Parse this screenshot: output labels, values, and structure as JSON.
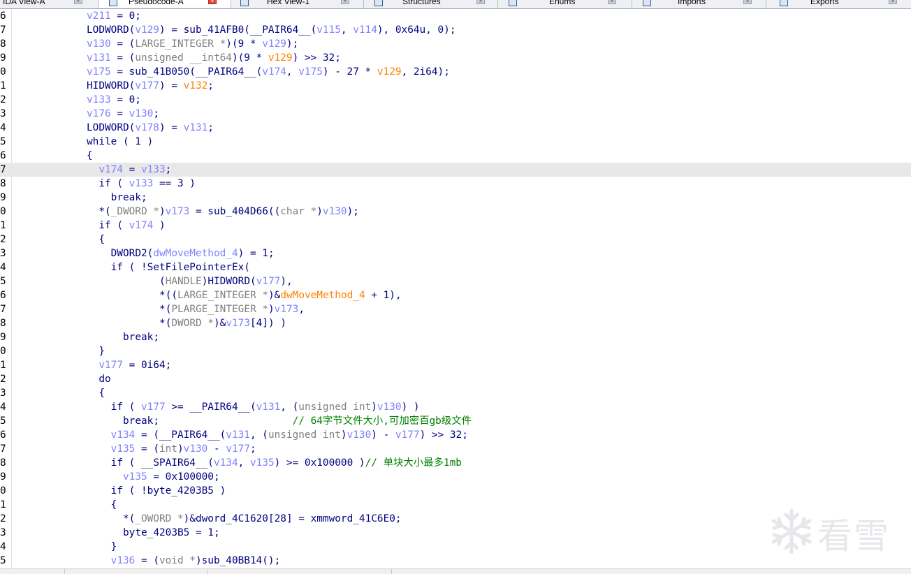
{
  "tabs": [
    {
      "label": "IDA View-A",
      "active": false
    },
    {
      "label": "Pseudocode-A",
      "active": true
    },
    {
      "label": "Hex View-1",
      "active": false
    },
    {
      "label": "Structures",
      "active": false
    },
    {
      "label": "Enums",
      "active": false
    },
    {
      "label": "Imports",
      "active": false
    },
    {
      "label": "Exports",
      "active": false
    }
  ],
  "watermark": {
    "text": "看雪",
    "icon": "snowflake-icon"
  },
  "colors": {
    "keyword": "#000080",
    "variable": "#8080ff",
    "type": "#808080",
    "global": "#ff8000",
    "comment": "#008000",
    "current_line": "#e8e8e8"
  },
  "code": {
    "current_line_index": 11,
    "lines": [
      {
        "no": "6",
        "indent": 0,
        "parts": [
          [
            "v",
            "v211"
          ],
          [
            "n",
            " = 0;"
          ]
        ]
      },
      {
        "no": "7",
        "indent": 0,
        "parts": [
          [
            "n",
            "LODWORD("
          ],
          [
            "v",
            "v129"
          ],
          [
            "n",
            ") = sub_41AFB0(__PAIR64__("
          ],
          [
            "v",
            "v115"
          ],
          [
            "n",
            ", "
          ],
          [
            "v",
            "v114"
          ],
          [
            "n",
            "), 0x64u, 0);"
          ]
        ]
      },
      {
        "no": "8",
        "indent": 0,
        "parts": [
          [
            "v",
            "v130"
          ],
          [
            "n",
            " = ("
          ],
          [
            "g",
            "LARGE_INTEGER *"
          ],
          [
            "n",
            ")(9 * "
          ],
          [
            "v",
            "v129"
          ],
          [
            "n",
            ");"
          ]
        ]
      },
      {
        "no": "9",
        "indent": 0,
        "parts": [
          [
            "v",
            "v131"
          ],
          [
            "n",
            " = ("
          ],
          [
            "g",
            "unsigned __int64"
          ],
          [
            "n",
            ")(9 * "
          ],
          [
            "o",
            "v129"
          ],
          [
            "n",
            ") >> 32;"
          ]
        ]
      },
      {
        "no": "0",
        "indent": 0,
        "parts": [
          [
            "v",
            "v175"
          ],
          [
            "n",
            " = sub_41B050(__PAIR64__("
          ],
          [
            "v",
            "v174"
          ],
          [
            "n",
            ", "
          ],
          [
            "v",
            "v175"
          ],
          [
            "n",
            ") - 27 * "
          ],
          [
            "o",
            "v129"
          ],
          [
            "n",
            ", 2i64);"
          ]
        ]
      },
      {
        "no": "1",
        "indent": 0,
        "parts": [
          [
            "n",
            "HIDWORD("
          ],
          [
            "v",
            "v177"
          ],
          [
            "n",
            ") = "
          ],
          [
            "o",
            "v132"
          ],
          [
            "n",
            ";"
          ]
        ]
      },
      {
        "no": "2",
        "indent": 0,
        "parts": [
          [
            "v",
            "v133"
          ],
          [
            "n",
            " = 0;"
          ]
        ]
      },
      {
        "no": "3",
        "indent": 0,
        "parts": [
          [
            "v",
            "v176"
          ],
          [
            "n",
            " = "
          ],
          [
            "v",
            "v130"
          ],
          [
            "n",
            ";"
          ]
        ]
      },
      {
        "no": "4",
        "indent": 0,
        "parts": [
          [
            "n",
            "LODWORD("
          ],
          [
            "v",
            "v178"
          ],
          [
            "n",
            ") = "
          ],
          [
            "v",
            "v131"
          ],
          [
            "n",
            ";"
          ]
        ]
      },
      {
        "no": "5",
        "indent": 0,
        "parts": [
          [
            "n",
            "while ( 1 )"
          ]
        ]
      },
      {
        "no": "6",
        "indent": 0,
        "parts": [
          [
            "n",
            "{"
          ]
        ]
      },
      {
        "no": "7",
        "indent": 2,
        "parts": [
          [
            "v",
            "v174"
          ],
          [
            "n",
            " = "
          ],
          [
            "v",
            "v133"
          ],
          [
            "n",
            ";"
          ]
        ]
      },
      {
        "no": "8",
        "indent": 2,
        "parts": [
          [
            "n",
            "if ( "
          ],
          [
            "v",
            "v133"
          ],
          [
            "n",
            " == 3 )"
          ]
        ]
      },
      {
        "no": "9",
        "indent": 4,
        "parts": [
          [
            "n",
            "break;"
          ]
        ]
      },
      {
        "no": "0",
        "indent": 2,
        "parts": [
          [
            "n",
            "*("
          ],
          [
            "g",
            "_DWORD *"
          ],
          [
            "n",
            ")"
          ],
          [
            "v",
            "v173"
          ],
          [
            "n",
            " = sub_404D66(("
          ],
          [
            "g",
            "char *"
          ],
          [
            "n",
            ")"
          ],
          [
            "v",
            "v130"
          ],
          [
            "n",
            ");"
          ]
        ]
      },
      {
        "no": "1",
        "indent": 2,
        "parts": [
          [
            "n",
            "if ( "
          ],
          [
            "v",
            "v174"
          ],
          [
            "n",
            " )"
          ]
        ]
      },
      {
        "no": "2",
        "indent": 2,
        "parts": [
          [
            "n",
            "{"
          ]
        ]
      },
      {
        "no": "3",
        "indent": 4,
        "parts": [
          [
            "n",
            "DWORD2("
          ],
          [
            "v",
            "dwMoveMethod_4"
          ],
          [
            "n",
            ") = 1;"
          ]
        ]
      },
      {
        "no": "4",
        "indent": 4,
        "parts": [
          [
            "n",
            "if ( !SetFilePointerEx("
          ]
        ]
      },
      {
        "no": "5",
        "indent": 12,
        "parts": [
          [
            "n",
            "("
          ],
          [
            "g",
            "HANDLE"
          ],
          [
            "n",
            ")HIDWORD("
          ],
          [
            "v",
            "v177"
          ],
          [
            "n",
            "),"
          ]
        ]
      },
      {
        "no": "6",
        "indent": 12,
        "parts": [
          [
            "n",
            "*(("
          ],
          [
            "g",
            "LARGE_INTEGER *"
          ],
          [
            "n",
            ")&"
          ],
          [
            "o",
            "dwMoveMethod_4"
          ],
          [
            "n",
            " + 1),"
          ]
        ]
      },
      {
        "no": "7",
        "indent": 12,
        "parts": [
          [
            "n",
            "*("
          ],
          [
            "g",
            "PLARGE_INTEGER *"
          ],
          [
            "n",
            ")"
          ],
          [
            "v",
            "v173"
          ],
          [
            "n",
            ","
          ]
        ]
      },
      {
        "no": "8",
        "indent": 12,
        "parts": [
          [
            "n",
            "*("
          ],
          [
            "g",
            "DWORD *"
          ],
          [
            "n",
            ")&"
          ],
          [
            "v",
            "v173"
          ],
          [
            "n",
            "[4]) )"
          ]
        ]
      },
      {
        "no": "9",
        "indent": 6,
        "parts": [
          [
            "n",
            "break;"
          ]
        ]
      },
      {
        "no": "0",
        "indent": 2,
        "parts": [
          [
            "n",
            "}"
          ]
        ]
      },
      {
        "no": "1",
        "indent": 2,
        "parts": [
          [
            "v",
            "v177"
          ],
          [
            "n",
            " = 0i64;"
          ]
        ]
      },
      {
        "no": "2",
        "indent": 2,
        "parts": [
          [
            "n",
            "do"
          ]
        ]
      },
      {
        "no": "3",
        "indent": 2,
        "parts": [
          [
            "n",
            "{"
          ]
        ]
      },
      {
        "no": "4",
        "indent": 4,
        "parts": [
          [
            "n",
            "if ( "
          ],
          [
            "v",
            "v177"
          ],
          [
            "n",
            " >= __PAIR64__("
          ],
          [
            "v",
            "v131"
          ],
          [
            "n",
            ", ("
          ],
          [
            "g",
            "unsigned int"
          ],
          [
            "n",
            ")"
          ],
          [
            "v",
            "v130"
          ],
          [
            "n",
            ") )"
          ]
        ]
      },
      {
        "no": "5",
        "indent": 6,
        "parts": [
          [
            "n",
            "break;"
          ],
          [
            "n",
            "                      "
          ],
          [
            "c",
            "// 64字节文件大小,可加密百gb级文件"
          ]
        ]
      },
      {
        "no": "6",
        "indent": 4,
        "parts": [
          [
            "v",
            "v134"
          ],
          [
            "n",
            " = (__PAIR64__("
          ],
          [
            "v",
            "v131"
          ],
          [
            "n",
            ", ("
          ],
          [
            "g",
            "unsigned int"
          ],
          [
            "n",
            ")"
          ],
          [
            "v",
            "v130"
          ],
          [
            "n",
            ") - "
          ],
          [
            "v",
            "v177"
          ],
          [
            "n",
            ") >> 32;"
          ]
        ]
      },
      {
        "no": "7",
        "indent": 4,
        "parts": [
          [
            "v",
            "v135"
          ],
          [
            "n",
            " = ("
          ],
          [
            "g",
            "int"
          ],
          [
            "n",
            ")"
          ],
          [
            "v",
            "v130"
          ],
          [
            "n",
            " - "
          ],
          [
            "v",
            "v177"
          ],
          [
            "n",
            ";"
          ]
        ]
      },
      {
        "no": "8",
        "indent": 4,
        "parts": [
          [
            "n",
            "if ( __SPAIR64__("
          ],
          [
            "v",
            "v134"
          ],
          [
            "n",
            ", "
          ],
          [
            "v",
            "v135"
          ],
          [
            "n",
            ") >= 0x100000 )"
          ],
          [
            "c",
            "// 单块大小最多1mb"
          ]
        ]
      },
      {
        "no": "9",
        "indent": 6,
        "parts": [
          [
            "v",
            "v135"
          ],
          [
            "n",
            " = 0x100000;"
          ]
        ]
      },
      {
        "no": "0",
        "indent": 4,
        "parts": [
          [
            "n",
            "if ( !byte_4203B5 )"
          ]
        ]
      },
      {
        "no": "1",
        "indent": 4,
        "parts": [
          [
            "n",
            "{"
          ]
        ]
      },
      {
        "no": "2",
        "indent": 6,
        "parts": [
          [
            "n",
            "*("
          ],
          [
            "g",
            "_OWORD *"
          ],
          [
            "n",
            ")&dword_4C1620[28] = xmmword_41C6E0;"
          ]
        ]
      },
      {
        "no": "3",
        "indent": 6,
        "parts": [
          [
            "n",
            "byte_4203B5 = 1;"
          ]
        ]
      },
      {
        "no": "4",
        "indent": 4,
        "parts": [
          [
            "n",
            "}"
          ]
        ]
      },
      {
        "no": "5",
        "indent": 4,
        "parts": [
          [
            "v",
            "v136"
          ],
          [
            "n",
            " = ("
          ],
          [
            "g",
            "void *"
          ],
          [
            "n",
            ")sub_40BB14();"
          ]
        ]
      }
    ]
  }
}
